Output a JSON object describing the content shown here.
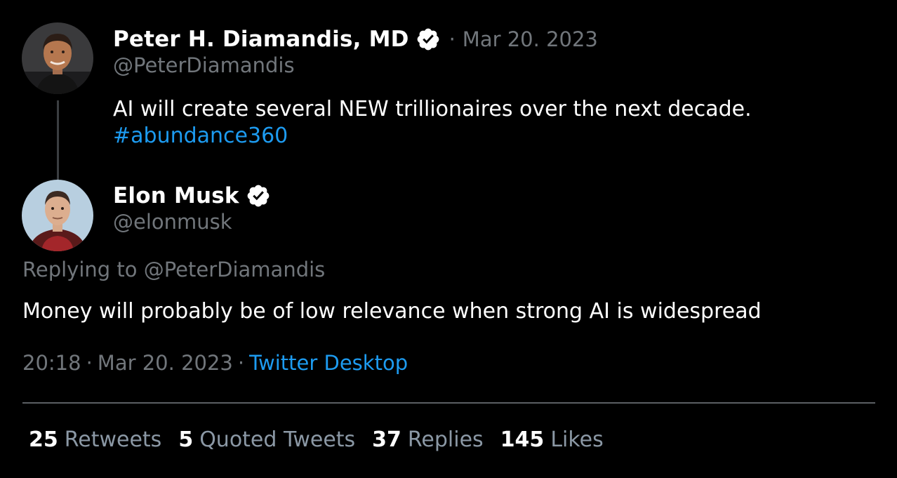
{
  "original_tweet": {
    "author": {
      "display_name": "Peter H. Diamandis, MD",
      "handle": "@PeterDiamandis",
      "verified": true,
      "avatar_icon": "avatar-peter-diamandis"
    },
    "separator": "·",
    "date": "Mar 20. 2023",
    "text": "AI will create several NEW trillionaires over the next decade.",
    "hashtag": "#abundance360"
  },
  "reply_tweet": {
    "author": {
      "display_name": "Elon Musk",
      "handle": "@elonmusk",
      "verified": true,
      "avatar_icon": "avatar-elon-musk"
    },
    "replying_to": "Replying to @PeterDiamandis",
    "text": "Money will probably be of low relevance when strong AI is widespread",
    "time": "20:18",
    "separator": "·",
    "date": "Mar 20. 2023",
    "source": "Twitter Desktop"
  },
  "stats": [
    {
      "count": "25",
      "label": "Retweets"
    },
    {
      "count": "5",
      "label": "Quoted Tweets"
    },
    {
      "count": "37",
      "label": "Replies"
    },
    {
      "count": "145",
      "label": "Likes"
    }
  ],
  "colors": {
    "background": "#000000",
    "primary_text": "#ffffff",
    "secondary_text": "#71767b",
    "link": "#1d9bf0",
    "verified_badge": "#ffffff"
  }
}
